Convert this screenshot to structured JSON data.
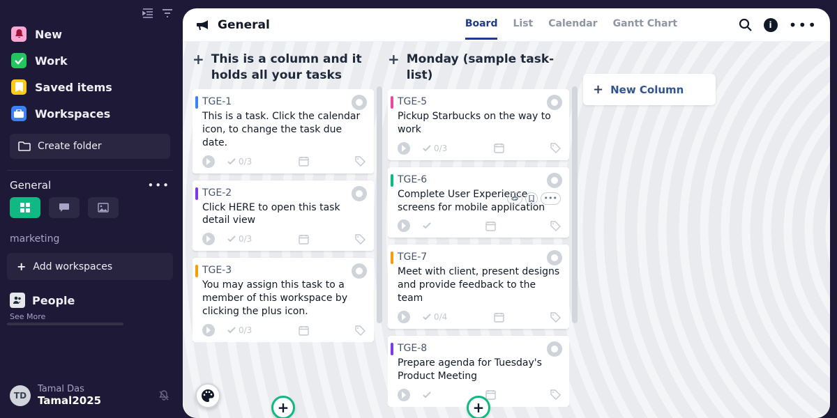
{
  "sidebar": {
    "nav": [
      {
        "icon": "bell",
        "color": "pink",
        "label": "New"
      },
      {
        "icon": "check",
        "color": "green",
        "label": "Work"
      },
      {
        "icon": "bookmark",
        "color": "yellow",
        "label": "Saved items"
      },
      {
        "icon": "briefcase",
        "color": "blue",
        "label": "Workspaces"
      }
    ],
    "create_folder": "Create folder",
    "workspace_group": "General",
    "marketing_label": "marketing",
    "add_workspaces": "Add workspaces",
    "people_label": "People",
    "see_more": "See More",
    "user": {
      "initials": "TD",
      "name": "Tamal Das",
      "handle": "Tamal2025"
    }
  },
  "header": {
    "title": "General",
    "tabs": [
      "Board",
      "List",
      "Calendar",
      "Gantt Chart"
    ],
    "active_tab": "Board"
  },
  "board": {
    "new_column": "New Column",
    "columns": [
      {
        "title": "This is a column and it holds all your tasks",
        "cards": [
          {
            "id": "TGE-1",
            "stripe": "#3b82f6",
            "desc": "This is a task. Click the calendar icon, to change the task due date.",
            "sub": "0/3"
          },
          {
            "id": "TGE-2",
            "stripe": "#7c3aed",
            "desc": "Click HERE to open this task detail view",
            "sub": "0/3"
          },
          {
            "id": "TGE-3",
            "stripe": "#f59e0b",
            "desc": "You may assign this task to a member of this workspace by clicking the plus icon.",
            "sub": "0/3"
          }
        ]
      },
      {
        "title": "Monday (sample task-list)",
        "cards": [
          {
            "id": "TGE-5",
            "stripe": "#ec4899",
            "desc": "Pickup Starbucks on the way to work",
            "sub": "0/3"
          },
          {
            "id": "TGE-6",
            "stripe": "#10b981",
            "desc": "Complete User Experience screens for mobile application",
            "sub": "",
            "pills": true
          },
          {
            "id": "TGE-7",
            "stripe": "#f59e0b",
            "desc": "Meet with client, present designs and provide feedback to the team",
            "sub": "0/4"
          },
          {
            "id": "TGE-8",
            "stripe": "#7c3aed",
            "desc": "Prepare agenda for Tuesday's Product Meeting",
            "sub": ""
          }
        ]
      }
    ]
  }
}
